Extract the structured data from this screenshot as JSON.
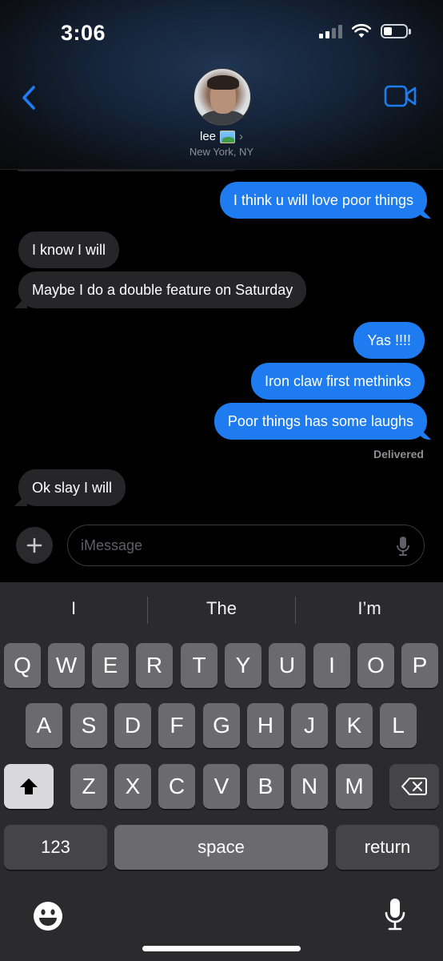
{
  "status": {
    "time": "3:06"
  },
  "header": {
    "contact_name": "lee",
    "contact_location": "New York, NY"
  },
  "messages": [
    {
      "side": "out",
      "text": "I think u will love poor things"
    },
    {
      "side": "in",
      "text": "I know I will"
    },
    {
      "side": "in",
      "text": "Maybe I do a double feature on Saturday"
    },
    {
      "side": "out",
      "text": "Yas !!!!"
    },
    {
      "side": "out",
      "text": "Iron claw first methinks"
    },
    {
      "side": "out",
      "text": "Poor things has some laughs"
    },
    {
      "side": "in",
      "text": "Ok slay I will"
    }
  ],
  "delivered_label": "Delivered",
  "input": {
    "placeholder": "iMessage",
    "value": ""
  },
  "keyboard": {
    "suggestions": [
      "I",
      "The",
      "I’m"
    ],
    "row1": [
      "Q",
      "W",
      "E",
      "R",
      "T",
      "Y",
      "U",
      "I",
      "O",
      "P"
    ],
    "row2": [
      "A",
      "S",
      "D",
      "F",
      "G",
      "H",
      "J",
      "K",
      "L"
    ],
    "row3": [
      "Z",
      "X",
      "C",
      "V",
      "B",
      "N",
      "M"
    ],
    "numbers_label": "123",
    "space_label": "space",
    "return_label": "return"
  },
  "colors": {
    "accent": "#1e7cf0",
    "incoming": "#262629",
    "keyboard_bg": "#2b2b2d"
  },
  "icons": [
    "back-chevron-icon",
    "video-camera-icon",
    "plus-icon",
    "microphone-icon",
    "shift-icon",
    "backspace-icon",
    "emoji-icon",
    "signal-icon",
    "wifi-icon",
    "battery-icon"
  ]
}
